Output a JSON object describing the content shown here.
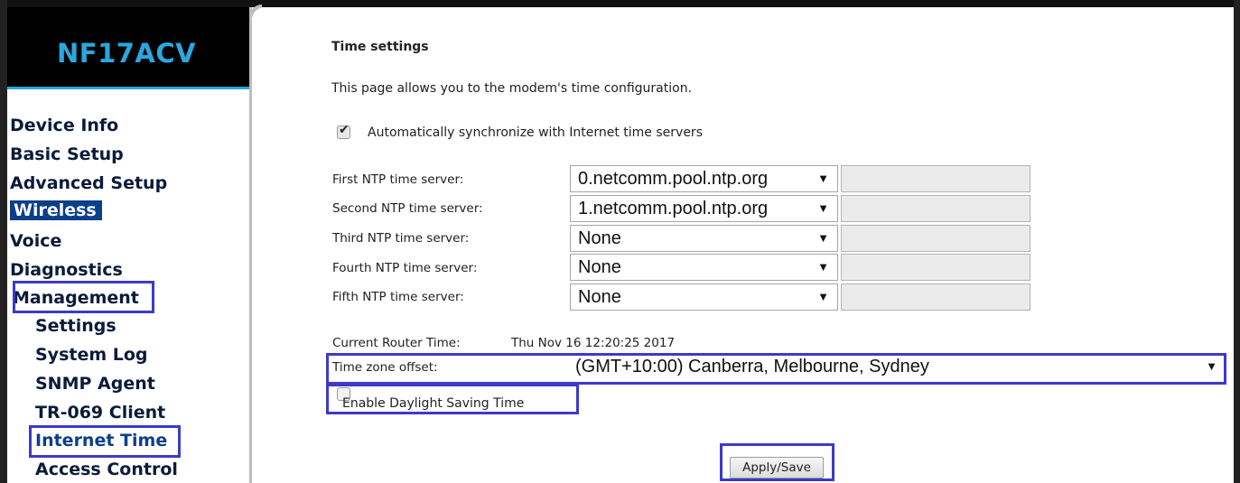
{
  "brand": {
    "logo_text": "NF17ACV",
    "accent_color": "#2aa7df"
  },
  "sidebar": {
    "items": [
      {
        "label": "Device Info"
      },
      {
        "label": "Basic Setup"
      },
      {
        "label": "Advanced Setup"
      },
      {
        "label": "Wireless"
      },
      {
        "label": "Voice"
      },
      {
        "label": "Diagnostics"
      },
      {
        "label": "Management"
      }
    ],
    "sub_items": [
      {
        "label": "Settings"
      },
      {
        "label": "System Log"
      },
      {
        "label": "SNMP Agent"
      },
      {
        "label": "TR-069 Client"
      },
      {
        "label": "Internet Time"
      },
      {
        "label": "Access Control"
      }
    ]
  },
  "page": {
    "title": "Time settings",
    "description": "This page allows you to the modem's time configuration.",
    "auto_sync_label": "Automatically synchronize with Internet time servers",
    "auto_sync_checked": true,
    "ntp_servers": [
      {
        "label": "First NTP time server:",
        "value": "0.netcomm.pool.ntp.org"
      },
      {
        "label": "Second NTP time server:",
        "value": "1.netcomm.pool.ntp.org"
      },
      {
        "label": "Third NTP time server:",
        "value": "None"
      },
      {
        "label": "Fourth NTP time server:",
        "value": "None"
      },
      {
        "label": "Fifth NTP time server:",
        "value": "None"
      }
    ],
    "current_time_label": "Current Router Time:",
    "current_time_value": "Thu Nov 16 12:20:25 2017",
    "timezone_label": "Time zone offset:",
    "timezone_value": "(GMT+10:00) Canberra, Melbourne, Sydney",
    "dst_label": "Enable Daylight Saving Time",
    "dst_checked": false,
    "apply_label": "Apply/Save"
  },
  "icons": {
    "dropdown": "dropdown-arrow-icon",
    "checkmark": "checkmark-icon"
  }
}
